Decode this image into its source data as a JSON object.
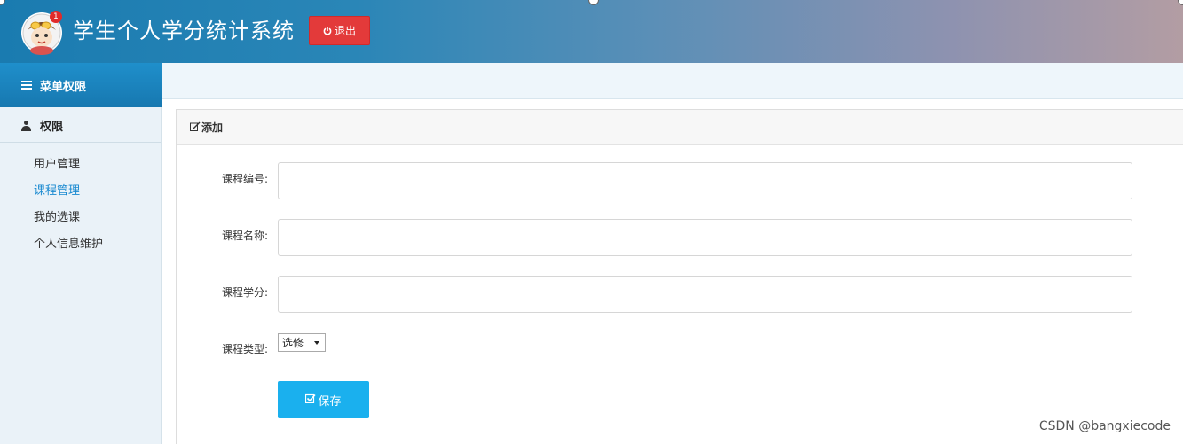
{
  "header": {
    "title": "学生个人学分统计系统",
    "logout_label": "退出",
    "notification_count": "1"
  },
  "sidebar": {
    "menu_title": "菜单权限",
    "section_title": "权限",
    "items": [
      {
        "label": "用户管理"
      },
      {
        "label": "课程管理",
        "active": true
      },
      {
        "label": "我的选课"
      },
      {
        "label": "个人信息维护"
      }
    ]
  },
  "panel": {
    "title": "添加"
  },
  "form": {
    "course_no_label": "课程编号:",
    "course_no_value": "",
    "course_name_label": "课程名称:",
    "course_name_value": "",
    "course_credit_label": "课程学分:",
    "course_credit_value": "",
    "course_type_label": "课程类型:",
    "course_type_value": "选修",
    "save_label": "保存"
  },
  "watermark": "CSDN @bangxiecode",
  "colors": {
    "header_start": "#1a7bb0",
    "header_end": "#b39da3",
    "logout": "#e33a3a",
    "accent": "#1ab0ee",
    "active_link": "#1a8ad0"
  }
}
